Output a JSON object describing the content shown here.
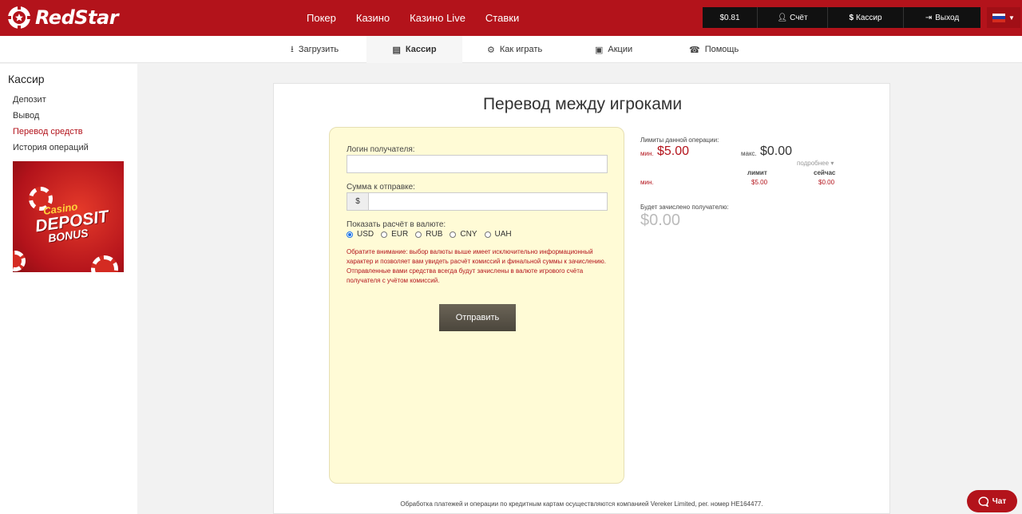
{
  "brand": {
    "name": "RedStar"
  },
  "main_nav": [
    "Покер",
    "Казино",
    "Казино Live",
    "Ставки"
  ],
  "account": {
    "balance": "$0.81",
    "account_label": "Счёт",
    "cashier_label": "Кассир",
    "logout_label": "Выход"
  },
  "sub_nav": [
    {
      "label": "Загрузить",
      "icon": "download-icon"
    },
    {
      "label": "Кассир",
      "icon": "wallet-icon"
    },
    {
      "label": "Как играть",
      "icon": "help-icon"
    },
    {
      "label": "Акции",
      "icon": "gift-icon"
    },
    {
      "label": "Помощь",
      "icon": "phone-icon"
    }
  ],
  "sidebar": {
    "title": "Кассир",
    "items": [
      "Депозит",
      "Вывод",
      "Перевод средств",
      "История операций"
    ],
    "active_index": 2,
    "banner": {
      "line1": "Casino",
      "line2": "DEPOSIT",
      "line3": "BONUS"
    }
  },
  "transfer": {
    "title": "Перевод между игроками",
    "recipient_label": "Логин получателя:",
    "recipient_value": "",
    "amount_label": "Сумма к отправке:",
    "amount_prefix": "$",
    "amount_value": "",
    "currency_label": "Показать расчёт в валюте:",
    "currencies": [
      "USD",
      "EUR",
      "RUB",
      "CNY",
      "UAH"
    ],
    "selected_currency": "USD",
    "notice": "Обратите внимание: выбор валюты выше имеет исключительно информационный характер и позволяет вам увидеть расчёт комиссий и финальной суммы к зачислению. Отправленные вами средства всегда будут зачислены в валюте игрового счёта получателя с учётом комиссий.",
    "submit_label": "Отправить"
  },
  "limits": {
    "title": "Лимиты данной операции:",
    "min_label": "мин.",
    "min_value": "$5.00",
    "max_label": "макс.",
    "max_value": "$0.00",
    "details_label": "подробнее",
    "col_limit": "лимит",
    "col_now": "сейчас",
    "row_label": "мин.",
    "row_limit": "$5.00",
    "row_now": "$0.00",
    "credited_label": "Будет зачислено получателю:",
    "credited_value": "$0.00"
  },
  "footer_note": "Обработка платежей и операции по кредитным картам осуществляются компанией Vereker Limited, рег. номер HE164477.",
  "chat_label": "Чат",
  "colors": {
    "brand_red": "#b3131b",
    "form_bg": "#fffbd6"
  }
}
